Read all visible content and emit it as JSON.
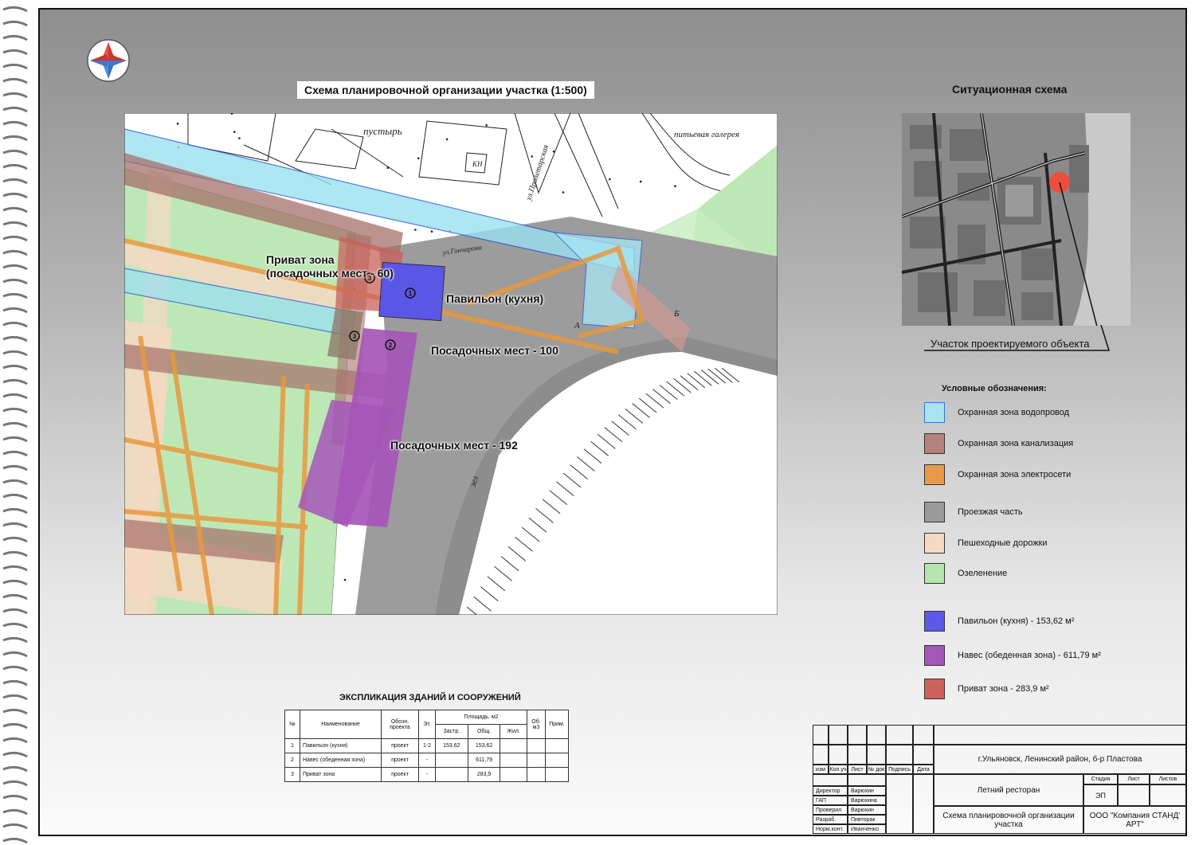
{
  "colors": {
    "water": "#99ddee",
    "sewer": "#b07d76",
    "electric": "#e69a4a",
    "road": "#9a9a9a",
    "pedestrian": "#f4d8c0",
    "green": "#b9e6b2",
    "pavilion": "#5a56e6",
    "canopy": "#a456b6",
    "private": "#c8615a"
  },
  "map": {
    "title": "Схема планировочной организации участка   (1:500)",
    "labels": {
      "private_zone_line1": "Приват зона",
      "private_zone_line2": "(посадочных мест - 60)",
      "pavilion": "Павильон (кухня)",
      "seats_100": "Посадочных мест - 100",
      "seats_192": "Посадочных мест - 192"
    },
    "survey_text": {
      "wasteland": "пустырь",
      "street_proletarskaya": "ул.Пролетарская",
      "street_goncharova": "ул.Гончарова",
      "gallery": "питьевая галерея",
      "kn": "КН",
      "letter_a": "А",
      "letter_b": "Б",
      "zeleny": "зел"
    },
    "markers": [
      "1",
      "2",
      "3",
      "3"
    ]
  },
  "situation": {
    "title": "Ситуационная схема",
    "caption": "Участок проектируемого объекта"
  },
  "legend": {
    "title": "Условные обозначения:",
    "items": [
      {
        "label": "Охранная зона водопровод",
        "color": "#a8e4f2",
        "border": "#2b7bd8"
      },
      {
        "label": "Охранная зона канализация",
        "color": "#b7817b",
        "border": "#333"
      },
      {
        "label": "Охранная зона электросети",
        "color": "#e89a4c",
        "border": "#333"
      },
      {
        "label": "Проезжая часть",
        "color": "#9a9a9a",
        "border": "#333"
      },
      {
        "label": "Пешеходные дорожки",
        "color": "#f4d9c4",
        "border": "#333"
      },
      {
        "label": "Озеленение",
        "color": "#b6e6b0",
        "border": "#333"
      },
      {
        "label": "Павильон (кухня) - 153,62 м²",
        "color": "#5c58e8",
        "border": "#333"
      },
      {
        "label": "Навес (обеденная зона) -  611,79 м²",
        "color": "#a457b8",
        "border": "#333"
      },
      {
        "label": "Приват зона - 283,9 м²",
        "color": "#cd625c",
        "border": "#333"
      }
    ]
  },
  "explication": {
    "title": "ЭКСПЛИКАЦИЯ ЗДАНИЙ И СООРУЖЕНИЙ",
    "headers": {
      "num": "№",
      "name": "Наименование",
      "code": "Обозн. проекта",
      "floors": "Эт.",
      "area": "Площадь, м2",
      "built": "Застр.",
      "total": "Общ.",
      "living": "Жил.",
      "volume": "Об. м3",
      "note": "Прим."
    },
    "rows": [
      {
        "num": "1",
        "name": "Павильон (кухня)",
        "code": "проект",
        "floors": "1-2",
        "built": "153,62",
        "total": "153,62",
        "living": "",
        "volume": "",
        "note": ""
      },
      {
        "num": "2",
        "name": "Навес (обеденная зона)",
        "code": "проект",
        "floors": "-",
        "built": "",
        "total": "611,79",
        "living": "",
        "volume": "",
        "note": ""
      },
      {
        "num": "3",
        "name": "Приват зона",
        "code": "проект",
        "floors": "-",
        "built": "",
        "total": "283,9",
        "living": "",
        "volume": "",
        "note": ""
      }
    ]
  },
  "stamp": {
    "address": "г.Ульяновск, Ленинский район, б-р Пластова",
    "col_headers": [
      "изм",
      "Кол.уч",
      "Лист",
      "№ док",
      "Подпись",
      "Дата"
    ],
    "object": "Летний ресторан",
    "sheet_title": "Схема планировочной организации участка",
    "company": "ООО \"Компания СТАНД' АРТ\"",
    "stage_label": "Стадия",
    "sheet_label": "Лист",
    "sheets_label": "Листов",
    "stage_value": "ЭП",
    "roles": [
      {
        "role": "Директор",
        "name": "Варюхин"
      },
      {
        "role": "ГАП",
        "name": "Варюхина"
      },
      {
        "role": "Проверил",
        "name": "Варюхин"
      },
      {
        "role": "Разраб.",
        "name": "Пивторак"
      },
      {
        "role": "Норм.конт.",
        "name": "Иванченко"
      }
    ]
  }
}
